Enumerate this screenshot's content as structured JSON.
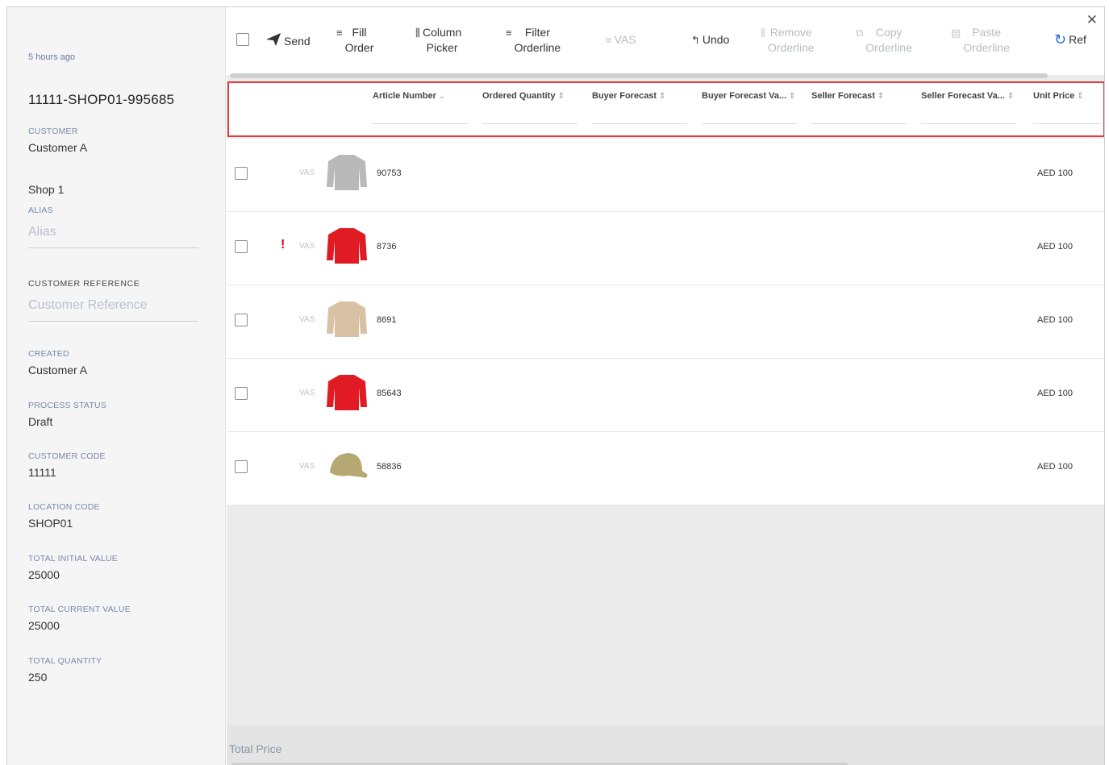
{
  "sidebar": {
    "time_ago": "5 hours ago",
    "order_id": "11111-SHOP01-995685",
    "customer_label": "CUSTOMER",
    "customer_value": "Customer A",
    "shop_value": "Shop 1",
    "alias_label": "ALIAS",
    "alias_placeholder": "Alias",
    "customer_ref_label": "CUSTOMER REFERENCE",
    "customer_ref_placeholder": "Customer Reference",
    "created_label": "CREATED",
    "created_value": "Customer A",
    "process_status_label": "PROCESS STATUS",
    "process_status_value": "Draft",
    "customer_code_label": "CUSTOMER CODE",
    "customer_code_value": "11111",
    "location_code_label": "LOCATION CODE",
    "location_code_value": "SHOP01",
    "total_initial_label": "TOTAL INITIAL VALUE",
    "total_initial_value": "25000",
    "total_current_label": "TOTAL CURRENT VALUE",
    "total_current_value": "25000",
    "total_quantity_label": "TOTAL QUANTITY",
    "total_quantity_value": "250"
  },
  "toolbar": {
    "send": "Send",
    "fill_order": "Fill\nOrder",
    "column_picker": "Column\nPicker",
    "filter_orderline": "Filter\nOrderline",
    "vas": "VAS",
    "undo": "Undo",
    "remove_orderline": "Remove\nOrderline",
    "copy_orderline": "Copy\nOrderline",
    "paste_orderline": "Paste\nOrderline",
    "refresh": "Ref"
  },
  "columns": {
    "article_number": "Article Number",
    "ordered_quantity": "Ordered Quantity",
    "buyer_forecast": "Buyer Forecast",
    "buyer_forecast_value": "Buyer Forecast Va...",
    "seller_forecast": "Seller Forecast",
    "seller_forecast_value": "Seller Forecast Va...",
    "unit_price": "Unit Price"
  },
  "rows": [
    {
      "article": "90753",
      "vas": "VAS",
      "price": "AED 100",
      "warning": "",
      "product": "grey-sweatshirt",
      "color": "#b9b9b9"
    },
    {
      "article": "8736",
      "vas": "VAS",
      "price": "AED 100",
      "warning": "!",
      "product": "red-sweatshirt",
      "color": "#e01b24"
    },
    {
      "article": "8691",
      "vas": "VAS",
      "price": "AED 100",
      "warning": "",
      "product": "beige-sweatshirt",
      "color": "#d9c2a3"
    },
    {
      "article": "85643",
      "vas": "VAS",
      "price": "AED 100",
      "warning": "",
      "product": "red-sweatshirt",
      "color": "#e01b24"
    },
    {
      "article": "58836",
      "vas": "VAS",
      "price": "AED 100",
      "warning": "",
      "product": "khaki-cap",
      "color": "#b5a872"
    }
  ],
  "footer": {
    "total_price_label": "Total Price"
  }
}
